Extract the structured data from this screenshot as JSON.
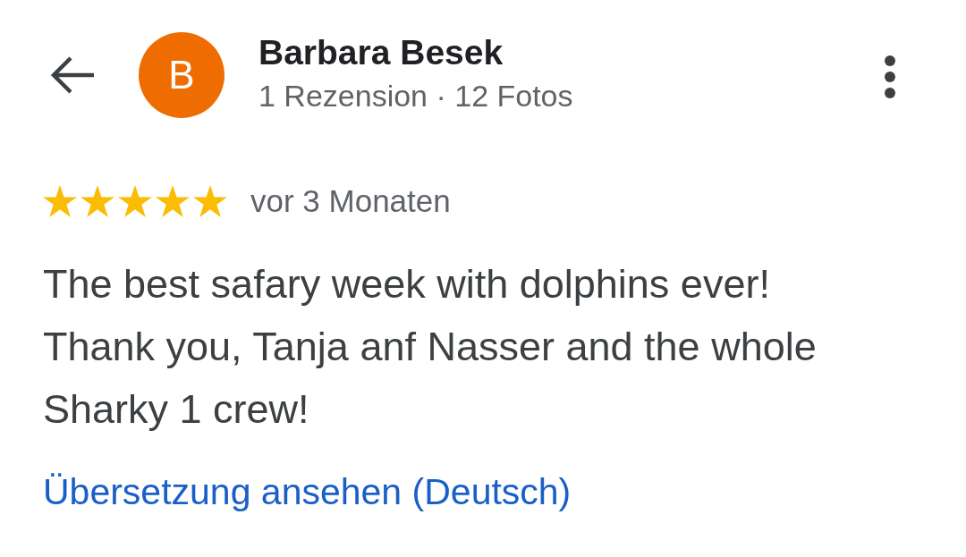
{
  "reviewer": {
    "avatar_letter": "B",
    "name": "Barbara Besek",
    "stats": "1 Rezension · 12 Fotos"
  },
  "review": {
    "stars": 5,
    "time": "vor 3 Monaten",
    "text": "The best safary week with dolphins ever!\nThank you, Tanja anf Nasser and the whole Sharky 1 crew!",
    "translate_link": "Übersetzung ansehen (Deutsch)"
  }
}
